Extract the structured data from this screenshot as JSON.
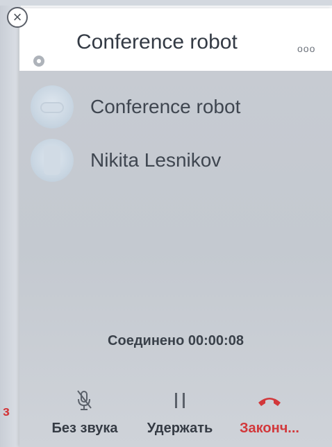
{
  "background": {
    "partial_text": "з"
  },
  "call_window": {
    "title": "Conference robot",
    "more_label": "ooo",
    "participants": [
      {
        "name": "Conference robot",
        "avatar": "bot-avatar"
      },
      {
        "name": "Nikita Lesnikov",
        "avatar": "user-avatar"
      }
    ],
    "status": "Соединено 00:00:08",
    "controls": {
      "mute_label": "Без звука",
      "hold_label": "Удержать",
      "end_label": "Законч..."
    }
  },
  "colors": {
    "end_call": "#d2383b",
    "panel_bg": "#c6cbd2",
    "header_bg": "#ffffff",
    "text_dark": "#3a414a"
  }
}
